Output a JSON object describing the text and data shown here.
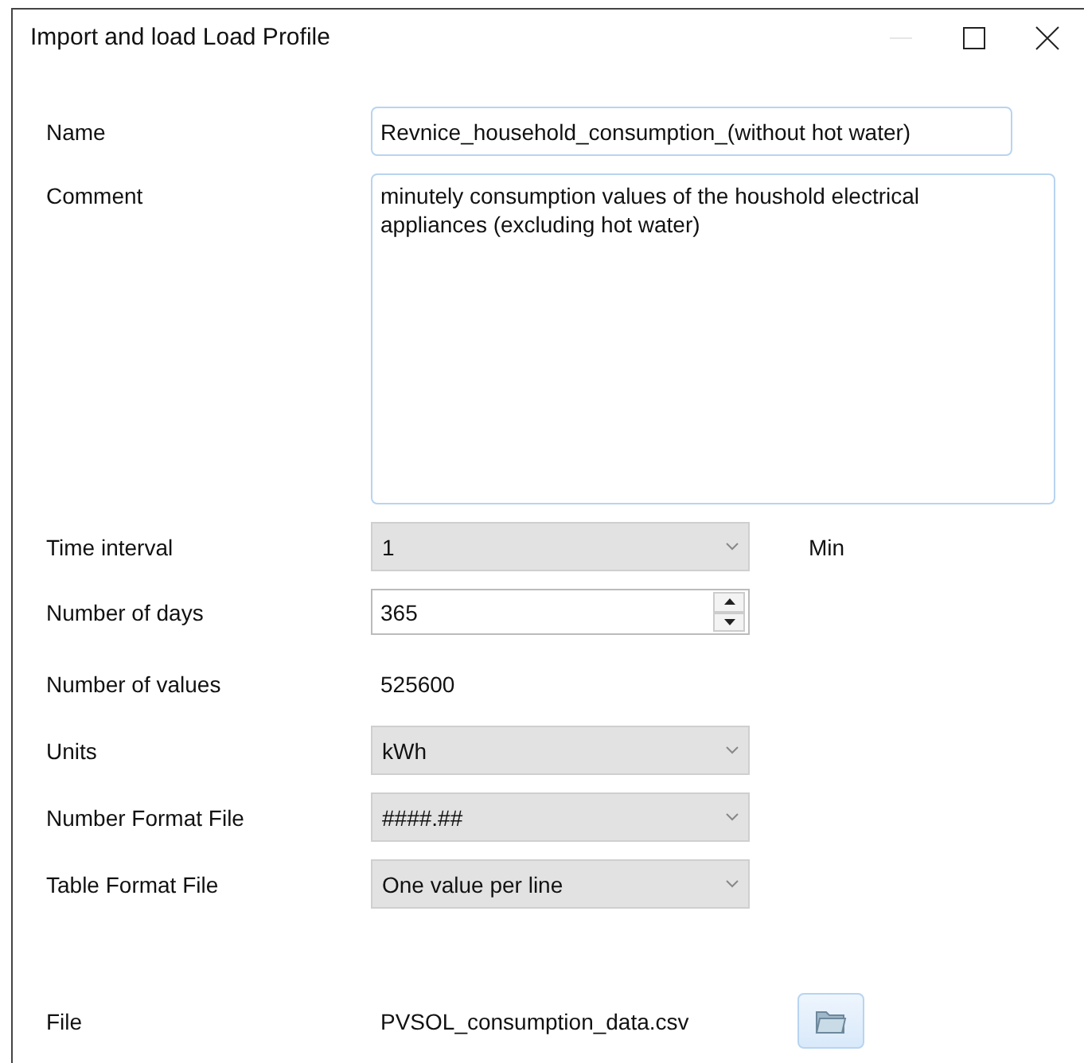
{
  "window": {
    "title": "Import and load Load Profile",
    "minimize_disabled": true
  },
  "fields": [
    {
      "kind": "text",
      "label": "Name",
      "value": "Revnice_household_consumption_(without hot water)"
    },
    {
      "kind": "textarea",
      "label": "Comment",
      "value": "minutely consumption values of the houshold electrical appliances (excluding hot water)"
    },
    {
      "kind": "select",
      "label": "Time interval",
      "value": "1",
      "unit": "Min"
    },
    {
      "kind": "spin",
      "label": "Number of days",
      "value": "365"
    },
    {
      "kind": "value",
      "label": "Number of values",
      "value": "525600"
    },
    {
      "kind": "select",
      "label": "Units",
      "value": "kWh"
    },
    {
      "kind": "select",
      "label": "Number Format File",
      "value": "####.##"
    },
    {
      "kind": "select",
      "label": "Table Format File",
      "value": "One value per line"
    },
    {
      "kind": "file",
      "label": "File",
      "value": "PVSOL_consumption_data.csv"
    }
  ]
}
